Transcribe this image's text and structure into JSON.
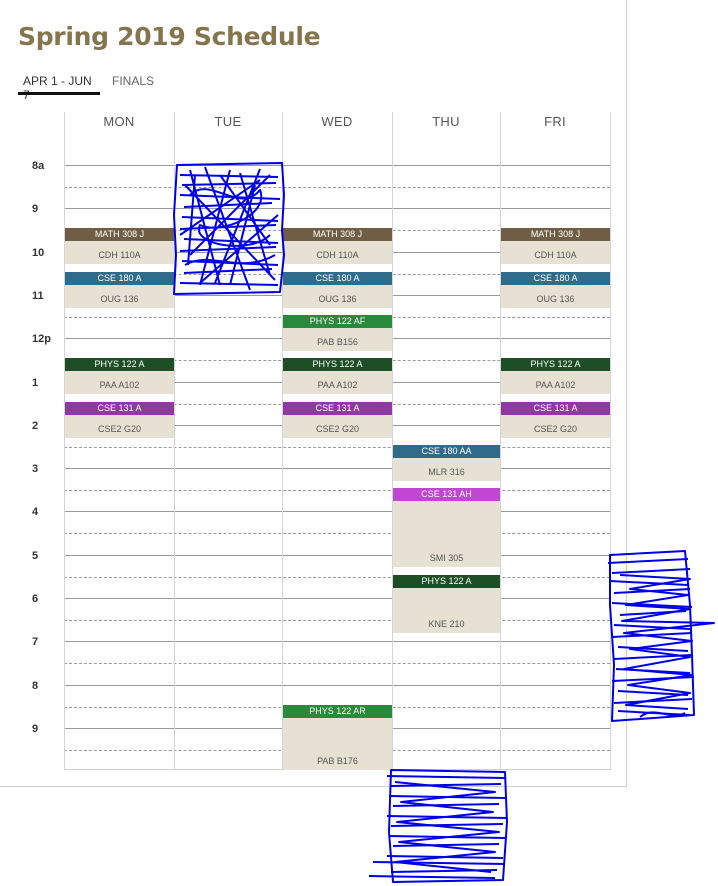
{
  "title": "Spring 2019 Schedule",
  "tabs": [
    {
      "label": "APR 1 - JUN 7",
      "active": true
    },
    {
      "label": "FINALS",
      "active": false
    }
  ],
  "days": [
    "MON",
    "TUE",
    "WED",
    "THU",
    "FRI"
  ],
  "time_labels": [
    "8a",
    "9",
    "10",
    "11",
    "12p",
    "1",
    "2",
    "3",
    "4",
    "5",
    "6",
    "7",
    "8",
    "9"
  ],
  "colors": {
    "title": "#85754d",
    "math": "#6f5e45",
    "cse180": "#2f6c8a",
    "phys122": "#1e4e25",
    "phys122_green": "#2a8a3b",
    "cse131": "#8e3aa2",
    "cse131_ah": "#c047d1",
    "event_body": "#e6e1d3",
    "scribble": "#0000e6"
  },
  "events": [
    {
      "day": "MON",
      "course": "MATH 308 J",
      "room": "CDH 110A",
      "start": "9:00",
      "end": "9:50",
      "color": "#6f5e45"
    },
    {
      "day": "MON",
      "course": "CSE 180 A",
      "room": "OUG 136",
      "start": "10:00",
      "end": "10:50",
      "color": "#2f6c8a"
    },
    {
      "day": "MON",
      "course": "PHYS 122 A",
      "room": "PAA A102",
      "start": "12:00",
      "end": "12:50",
      "color": "#1e4e25"
    },
    {
      "day": "MON",
      "course": "CSE 131 A",
      "room": "CSE2 G20",
      "start": "13:00",
      "end": "13:50",
      "color": "#8e3aa2"
    },
    {
      "day": "WED",
      "course": "MATH 308 J",
      "room": "CDH 110A",
      "start": "9:00",
      "end": "9:50",
      "color": "#6f5e45"
    },
    {
      "day": "WED",
      "course": "CSE 180 A",
      "room": "OUG 136",
      "start": "10:00",
      "end": "10:50",
      "color": "#2f6c8a"
    },
    {
      "day": "WED",
      "course": "PHYS 122 AF",
      "room": "PAB B156",
      "start": "11:00",
      "end": "11:50",
      "color": "#2a8a3b"
    },
    {
      "day": "WED",
      "course": "PHYS 122 A",
      "room": "PAA A102",
      "start": "12:00",
      "end": "12:50",
      "color": "#1e4e25"
    },
    {
      "day": "WED",
      "course": "CSE 131 A",
      "room": "CSE2 G20",
      "start": "13:00",
      "end": "13:50",
      "color": "#8e3aa2"
    },
    {
      "day": "WED",
      "course": "PHYS 122 AR",
      "room": "PAB B176",
      "start": "20:00",
      "end": "21:30",
      "color": "#2a8a3b"
    },
    {
      "day": "THU",
      "course": "CSE 180 AA",
      "room": "MLR 316",
      "start": "14:00",
      "end": "14:50",
      "color": "#2f6c8a"
    },
    {
      "day": "THU",
      "course": "CSE 131 AH",
      "room": "SMI 305",
      "start": "15:00",
      "end": "16:50",
      "color": "#c047d1"
    },
    {
      "day": "THU",
      "course": "PHYS 122 A",
      "room": "KNE 210",
      "start": "17:00",
      "end": "18:20",
      "color": "#1e4e25"
    },
    {
      "day": "FRI",
      "course": "MATH 308 J",
      "room": "CDH 110A",
      "start": "9:00",
      "end": "9:50",
      "color": "#6f5e45"
    },
    {
      "day": "FRI",
      "course": "CSE 180 A",
      "room": "OUG 136",
      "start": "10:00",
      "end": "10:50",
      "color": "#2f6c8a"
    },
    {
      "day": "FRI",
      "course": "PHYS 122 A",
      "room": "PAA A102",
      "start": "12:00",
      "end": "12:50",
      "color": "#1e4e25"
    },
    {
      "day": "FRI",
      "course": "CSE 131 A",
      "room": "CSE2 G20",
      "start": "13:00",
      "end": "13:50",
      "color": "#8e3aa2"
    }
  ]
}
